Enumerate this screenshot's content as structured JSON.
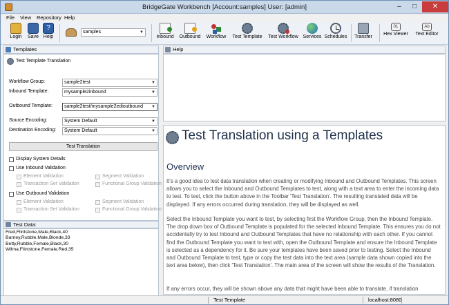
{
  "window": {
    "title": "BridgeGate Workbench [Account:samples] User: [admin]",
    "minimize": "–",
    "maximize": "□",
    "close": "✕"
  },
  "menu": {
    "file": "File",
    "view": "View",
    "repository": "Repository",
    "help": "Help"
  },
  "toolbar": {
    "login": "Login",
    "save": "Save",
    "help": "Help",
    "account_value": "samples",
    "inbound": "Inbound",
    "outbound": "Outbound",
    "workflow": "Workflow",
    "test_template": "Test Template",
    "test_workflow": "Test Workflow",
    "services": "Services",
    "schedules": "Schedules",
    "transfer": "Transfer",
    "hex_viewer": "Hex Viewer",
    "text_editor": "Text Editor"
  },
  "templates_panel": {
    "header": "Templates",
    "title": "Test Template Translation",
    "workflow_group_label": "Workflow Group:",
    "workflow_group_value": "sample2test",
    "inbound_template_label": "Inbound Template:",
    "inbound_template_value": "mysample2inbound",
    "outbound_template_label": "Outbound Template:",
    "outbound_template_value": "sample2test/mysample2edioutbound",
    "source_encoding_label": "Source Encoding:",
    "source_encoding_value": "System Default",
    "destination_encoding_label": "Destination Encoding:",
    "destination_encoding_value": "System Default",
    "test_button": "Test Translation",
    "display_system_details": "Display System Details",
    "use_inbound_validation": "Use Inbound Validation",
    "use_outbound_validation": "Use Outbound Validation",
    "element_validation": "Element Validation",
    "segment_validation": "Segment Validation",
    "transaction_set_validation": "Transaction Set Validation",
    "functional_group_validation": "Functional Group Validation"
  },
  "test_data": {
    "header": "Test Data:",
    "lines": [
      "Fred,Flintstone,Male,Black,40",
      "Barney,Rubble,Male,Blonde,33",
      "Betty,Rubble,Female,Black,30",
      "Wilma,Flintstone,Female,Red,35"
    ]
  },
  "help": {
    "header": "Help",
    "title": "Test Translation using a Templates",
    "overview": "Overview",
    "p1": "It's a good idea to test data translation when creating or modifying Inbound and Outbound Templates. This screen allows you to select the Inbound and Outbound Templates to test, along with a text area to enter the incoming data to test. To test, click the button above in the Toolbar 'Test Translation'. The resulting translated data will be displayed. If any errors occurred during translation, they will be displayed as well.",
    "p2": "Select the Inbound Template you want to test, by selecting first the Workflow Group, then the Inbound Template. The drop down box of Outbound Template is populated for the selected Inbound Template. This ensures you do not accidentally try to test Inbound and Outbound Templates that have no relationship with each other. If you cannot find the Outbound Template you want to test with, open the Outbound Template and ensure the Inbound Template is selected as a dependency for it. Be sure your templates have been saved prior to testing. Select the Inbound and Outbound Template to test, type or copy the test data into the text area (sample data shown copied into the text area below), then click 'Test Translation'. The main area of the screen will show the results of the Translation.",
    "p3": "If any errors occur, they will be shown above any data that might have been able to translate, if translation"
  },
  "status": {
    "center": "Test Template",
    "server": "localhost:8080"
  },
  "colors": {
    "accent": "#3d6fa8",
    "title_bar": "#c9d9ea",
    "close_button": "#c83c3c"
  }
}
